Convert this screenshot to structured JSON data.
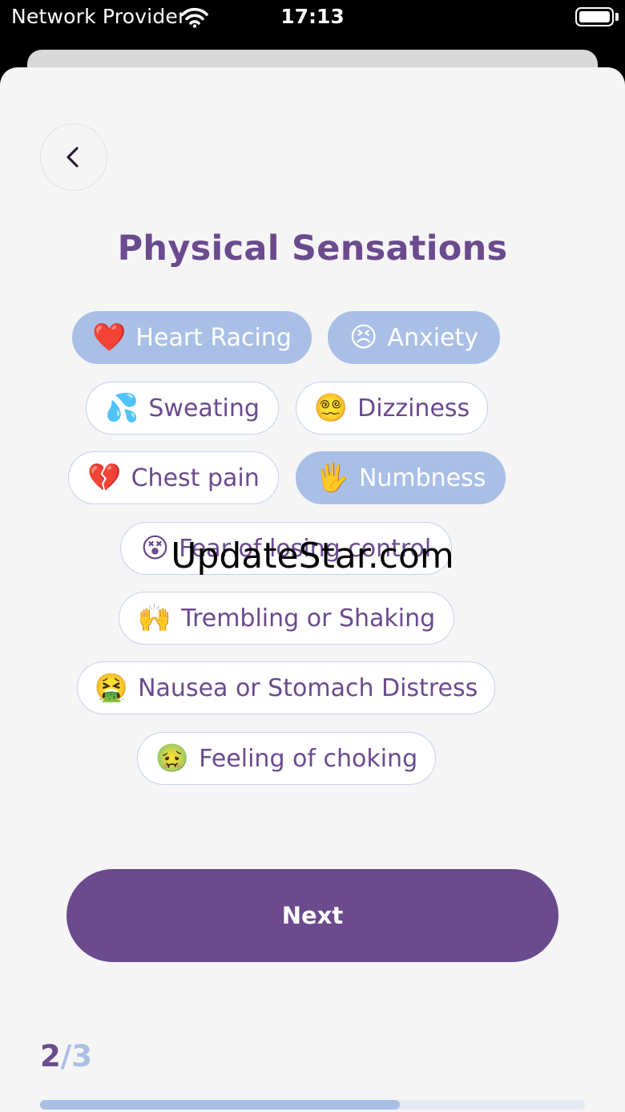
{
  "status_bar": {
    "carrier": "Network Provider",
    "time": "17:13",
    "wifi_icon": "wifi-icon",
    "battery_icon": "battery-full-icon"
  },
  "header": {
    "back_icon": "chevron-left-icon",
    "title": "Physical Sensations"
  },
  "sensations": [
    {
      "emoji": "❤️",
      "label": "Heart Racing",
      "selected": true
    },
    {
      "emoji": "😣",
      "label": "Anxiety",
      "selected": true
    },
    {
      "emoji": "💦",
      "label": "Sweating",
      "selected": false
    },
    {
      "emoji": "😵‍💫",
      "label": "Dizziness",
      "selected": false
    },
    {
      "emoji": "💔",
      "label": "Chest pain",
      "selected": false
    },
    {
      "emoji": "🖐️",
      "label": "Numbness",
      "selected": true
    },
    {
      "emoji": "😵",
      "label": "Fear of losing control",
      "selected": false
    },
    {
      "emoji": "🙌",
      "label": "Trembling or Shaking",
      "selected": false
    },
    {
      "emoji": "🤮",
      "label": "Nausea or Stomach Distress",
      "selected": false
    },
    {
      "emoji": "🤢",
      "label": "Feeling of choking",
      "selected": false
    }
  ],
  "watermark": "UpdateStar.com",
  "next_button": {
    "label": "Next"
  },
  "progress": {
    "current": "2",
    "separator": "/",
    "total": "3",
    "fraction": 0.66
  },
  "colors": {
    "primary": "#6b4a8e",
    "chip_selected": "#a9bfe6",
    "chip_border": "#c5d2ea",
    "background": "#f5f5f6"
  }
}
